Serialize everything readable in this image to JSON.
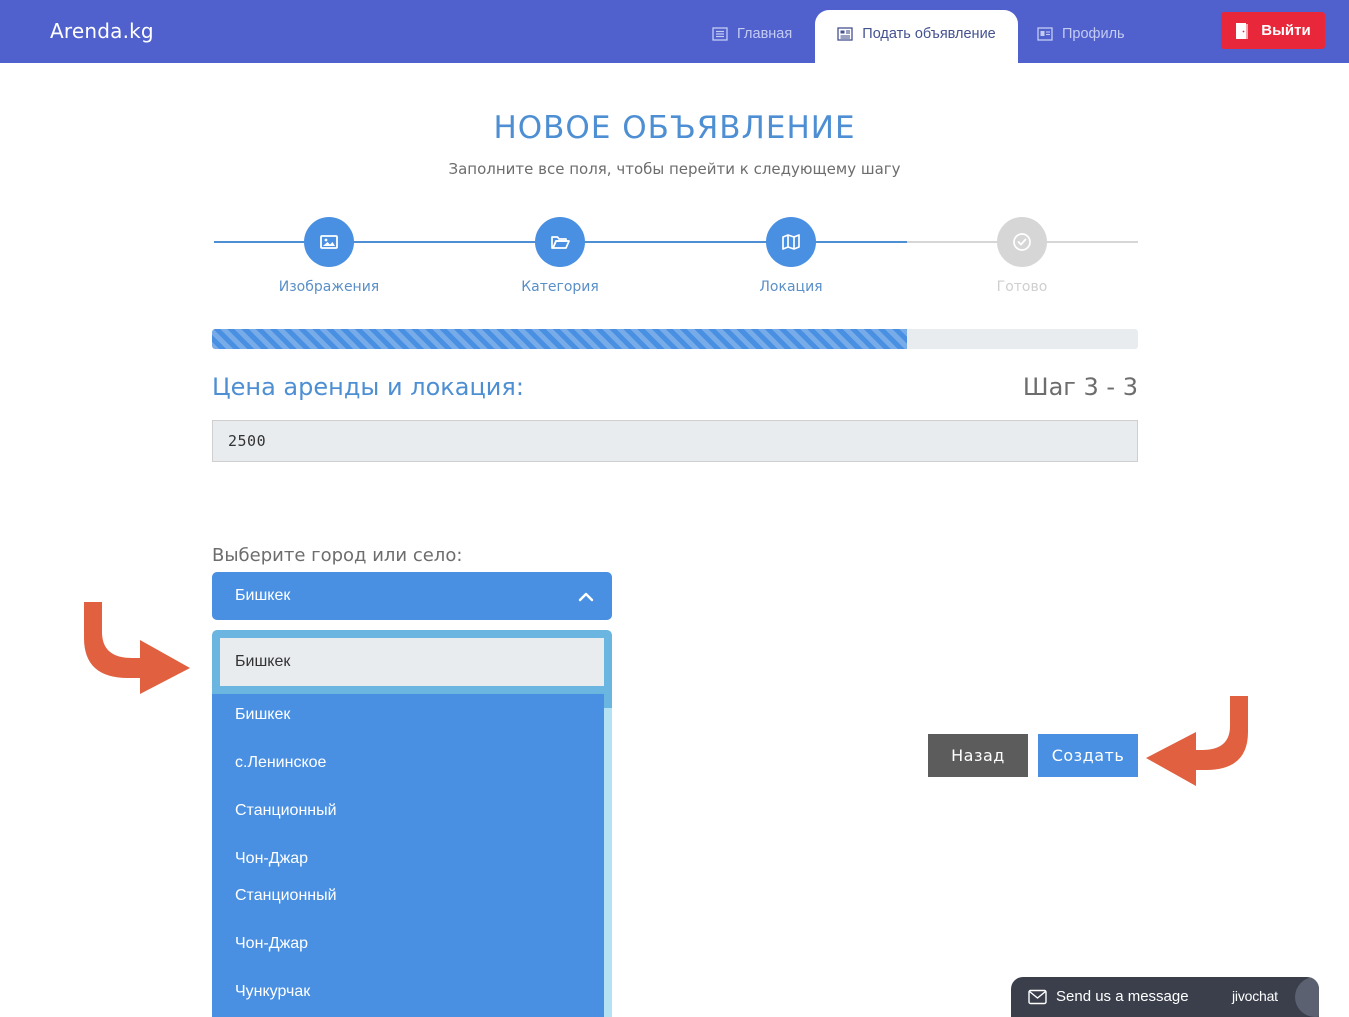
{
  "navbar": {
    "brand": "Arenda.kg",
    "items": [
      {
        "label": "Главная",
        "icon": "list-icon"
      },
      {
        "label": "Подать объявление",
        "icon": "newspaper-icon"
      },
      {
        "label": "Профиль",
        "icon": "id-card-icon"
      }
    ],
    "logout_label": "Выйти"
  },
  "header": {
    "title": "НОВОЕ ОБЪЯВЛЕНИЕ",
    "subtitle": "Заполните все поля, чтобы перейти к следующему шагу"
  },
  "steps": [
    {
      "label": "Изображения",
      "icon": "image-icon",
      "state": "done"
    },
    {
      "label": "Категория",
      "icon": "folder-open-icon",
      "state": "done"
    },
    {
      "label": "Локация",
      "icon": "map-icon",
      "state": "done"
    },
    {
      "label": "Готово",
      "icon": "check-circle-icon",
      "state": "todo"
    }
  ],
  "progress": {
    "fraction": 0.75
  },
  "section": {
    "title": "Цена аренды и локация:",
    "step_count": "Шаг 3 - 3"
  },
  "price": {
    "value": "2500"
  },
  "city": {
    "label": "Выберите город или село:",
    "selected": "Бишкек",
    "search_value": "Бишкек",
    "options": [
      "Бишкек",
      "с.Ленинское",
      "Станционный",
      "Чон-Джар",
      "Станционный",
      "Чон-Джар",
      "Чункурчак"
    ]
  },
  "buttons": {
    "back": "Назад",
    "create": "Создать"
  },
  "chat": {
    "label": "Send us a message",
    "brand": "jivochat"
  },
  "colors": {
    "navbar": "#5061cd",
    "accent": "#4a90e2",
    "danger": "#e8273a",
    "arrow": "#e0603f"
  }
}
